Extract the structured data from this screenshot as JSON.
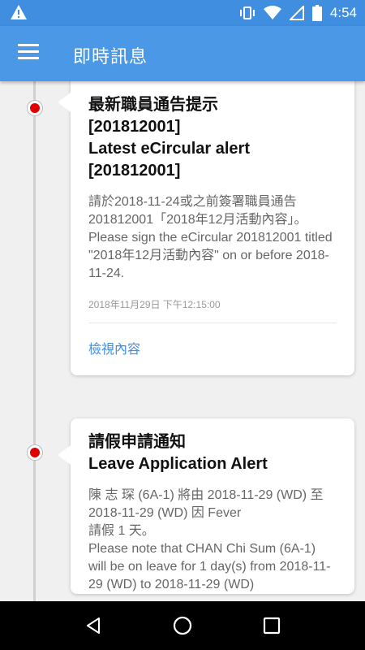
{
  "status_bar": {
    "time": "4:54"
  },
  "app_bar": {
    "title": "即時訊息"
  },
  "messages": [
    {
      "title_zh": "最新職員通告提示",
      "title_zh_code": "[201812001]",
      "title_en": "Latest eCircular alert",
      "title_en_code": "[201812001]",
      "body_zh": "請於2018-11-24或之前簽署職員通告201812001「2018年12月活動內容」。",
      "body_en": "Please sign the eCircular 201812001 titled \"2018年12月活動內容\" on or before 2018-11-24.",
      "timestamp": "2018年11月29日 下午12:15:00",
      "link": "檢視內容"
    },
    {
      "title_zh": "請假申請通知",
      "title_en": "Leave Application Alert",
      "body_zh_1": "陳 志 琛 (6A-1) 將由 2018-11-29 (WD) 至 2018-11-29 (WD) 因 Fever",
      "body_zh_2": " 請假 1 天。",
      "body_en": "Please note that CHAN Chi Sum (6A-1) will be on leave for 1 day(s) from 2018-11-29 (WD) to 2018-11-29 (WD)"
    }
  ]
}
